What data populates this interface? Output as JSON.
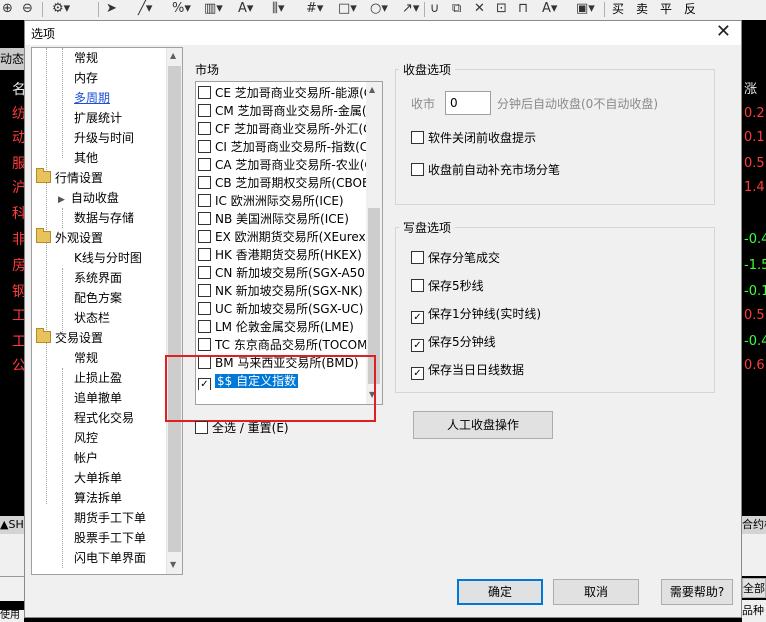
{
  "toolbar": {
    "right_labels": [
      "买",
      "卖",
      "平",
      "反"
    ]
  },
  "background": {
    "header": "动态显",
    "row_chars": [
      "名",
      "纺",
      "动",
      "服",
      "沪",
      "科",
      "非",
      "房",
      "钢",
      "工",
      "工",
      "公"
    ],
    "right_header": "涨",
    "values": [
      "0.2",
      "0.1",
      "0.5",
      "1.4",
      "-0.4",
      "-1.5",
      "-0.1",
      "0.5",
      "-0.4",
      "0.6"
    ],
    "bottom_right": "合约栏",
    "bottom_right2": "全部",
    "bottom_left": "▲SH",
    "bottom_left2": "品种",
    "footer": "使用"
  },
  "dialog": {
    "title": "选项",
    "close": "✕",
    "tree": [
      {
        "label": "常规",
        "level": 2
      },
      {
        "label": "内存",
        "level": 2
      },
      {
        "label": "多周期",
        "level": 2,
        "link": true
      },
      {
        "label": "扩展统计",
        "level": 2
      },
      {
        "label": "升级与时间",
        "level": 2
      },
      {
        "label": "其他",
        "level": 2
      },
      {
        "label": "行情设置",
        "level": 1,
        "folder": true
      },
      {
        "label": "自动收盘",
        "level": 2,
        "current": true
      },
      {
        "label": "数据与存储",
        "level": 2
      },
      {
        "label": "外观设置",
        "level": 1,
        "folder": true
      },
      {
        "label": "K线与分时图",
        "level": 2
      },
      {
        "label": "系统界面",
        "level": 2
      },
      {
        "label": "配色方案",
        "level": 2
      },
      {
        "label": "状态栏",
        "level": 2
      },
      {
        "label": "交易设置",
        "level": 1,
        "folder": true
      },
      {
        "label": "常规",
        "level": 2
      },
      {
        "label": "止损止盈",
        "level": 2
      },
      {
        "label": "追单撤单",
        "level": 2
      },
      {
        "label": "程式化交易",
        "level": 2
      },
      {
        "label": "风控",
        "level": 2
      },
      {
        "label": "帐户",
        "level": 2
      },
      {
        "label": "大单拆单",
        "level": 2
      },
      {
        "label": "算法拆单",
        "level": 2
      },
      {
        "label": "期货手工下单",
        "level": 2
      },
      {
        "label": "股票手工下单",
        "level": 2
      },
      {
        "label": "闪电下单界面",
        "level": 2
      }
    ],
    "market": {
      "label": "市场",
      "items": [
        {
          "text": "CE 芝加哥商业交易所-能源(C",
          "checked": false
        },
        {
          "text": "CM 芝加哥商业交易所-金属(",
          "checked": false
        },
        {
          "text": "CF 芝加哥商业交易所-外汇(C",
          "checked": false
        },
        {
          "text": "CI 芝加哥商业交易所-指数(C",
          "checked": false
        },
        {
          "text": "CA 芝加哥商业交易所-农业(C",
          "checked": false
        },
        {
          "text": "CB 芝加哥期权交易所(CBOE",
          "checked": false
        },
        {
          "text": "IC 欧洲洲际交易所(ICE)",
          "checked": false
        },
        {
          "text": "NB 美国洲际交易所(ICE)",
          "checked": false
        },
        {
          "text": "EX 欧洲期货交易所(XEurex)",
          "checked": false
        },
        {
          "text": "HK 香港期货交易所(HKEX)",
          "checked": false
        },
        {
          "text": "CN 新加坡交易所(SGX-A50)",
          "checked": false
        },
        {
          "text": "NK 新加坡交易所(SGX-NK)",
          "checked": false
        },
        {
          "text": "UC 新加坡交易所(SGX-UC)",
          "checked": false
        },
        {
          "text": "LM 伦敦金属交易所(LME)",
          "checked": false
        },
        {
          "text": "TC 东京商品交易所(TOCOM",
          "checked": false
        },
        {
          "text": "BM 马来西亚交易所(BMD)",
          "checked": false
        },
        {
          "text": "$$ 自定义指数",
          "checked": true,
          "selected": true
        }
      ],
      "select_all": "全选 / 重置(E)"
    },
    "close_opts": {
      "title": "收盘选项",
      "label_close": "收市",
      "value": "0",
      "suffix": "分钟后自动收盘(0不自动收盘)",
      "opt1": "软件关闭前收盘提示",
      "opt2": "收盘前自动补充市场分笔"
    },
    "write_opts": {
      "title": "写盘选项",
      "items": [
        {
          "label": "保存分笔成交",
          "checked": false
        },
        {
          "label": "保存5秒线",
          "checked": false
        },
        {
          "label": "保存1分钟线(实时线)",
          "checked": true
        },
        {
          "label": "保存5分钟线",
          "checked": true
        },
        {
          "label": "保存当日日线数据",
          "checked": true
        }
      ]
    },
    "manual_button": "人工收盘操作",
    "ok": "确定",
    "cancel": "取消",
    "help": "需要帮助?"
  }
}
